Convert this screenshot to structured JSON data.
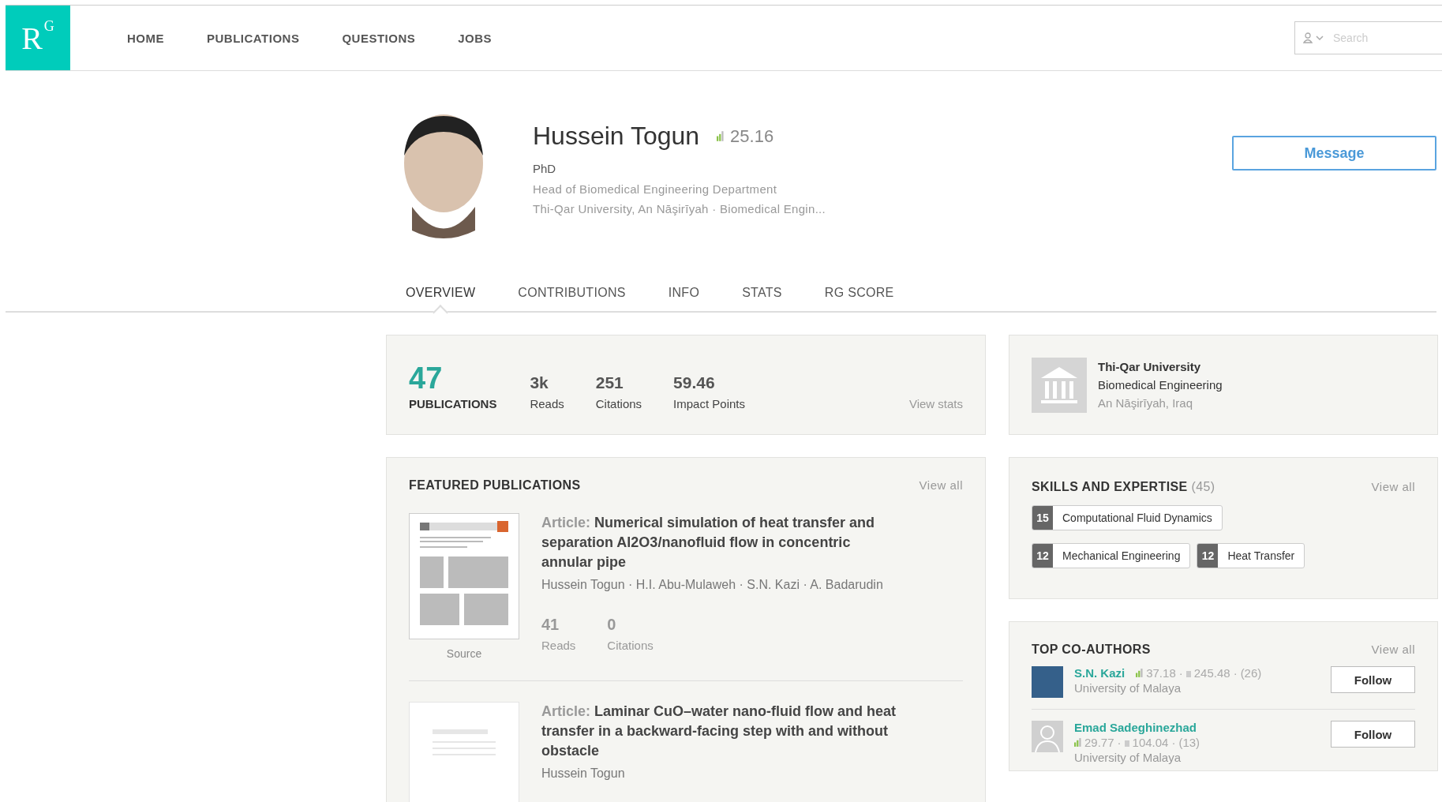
{
  "logo": {
    "letter": "R",
    "superscript": "G"
  },
  "nav": [
    {
      "label": "HOME"
    },
    {
      "label": "PUBLICATIONS"
    },
    {
      "label": "QUESTIONS"
    },
    {
      "label": "JOBS"
    }
  ],
  "search": {
    "placeholder": "Search"
  },
  "profile": {
    "name": "Hussein Togun",
    "score": "25.16",
    "degree": "PhD",
    "position": "Head of Biomedical Engineering Department",
    "affiliation": "Thi-Qar University, An Nāşirīyah · Biomedical Engin..."
  },
  "message_button": "Message",
  "tabs": [
    {
      "label": "OVERVIEW",
      "selected": true
    },
    {
      "label": "CONTRIBUTIONS",
      "selected": false
    },
    {
      "label": "INFO",
      "selected": false
    },
    {
      "label": "STATS",
      "selected": false
    },
    {
      "label": "RG SCORE",
      "selected": false
    }
  ],
  "stats": {
    "publications": {
      "value": "47",
      "label": "PUBLICATIONS"
    },
    "items": [
      {
        "value": "3k",
        "label": "Reads"
      },
      {
        "value": "251",
        "label": "Citations"
      },
      {
        "value": "59.46",
        "label": "Impact Points"
      }
    ],
    "link": "View stats"
  },
  "institution": {
    "name": "Thi-Qar University",
    "department": "Biomedical Engineering",
    "location": "An Nāşirīyah, Iraq"
  },
  "featured": {
    "title": "FEATURED PUBLICATIONS",
    "link": "View all",
    "items": [
      {
        "kind": "document",
        "source": "Source",
        "type": "Article:",
        "title": "Numerical simulation of heat transfer and separation Al2O3/nanofluid flow in concentric annular pipe",
        "authors": "Hussein Togun · H.I. Abu-Mulaweh · S.N. Kazi · A. Badarudin",
        "reads": "41",
        "reads_label": "Reads",
        "citations": "0",
        "citations_label": "Citations"
      },
      {
        "kind": "blank",
        "type": "Article:",
        "title": "Laminar CuO–water nano-fluid flow and heat transfer in a backward-facing step with and without obstacle",
        "authors": "Hussein Togun"
      }
    ]
  },
  "skills": {
    "title": "SKILLS AND EXPERTISE",
    "count": "(45)",
    "link": "View all",
    "items": [
      {
        "count": "15",
        "name": "Computational Fluid Dynamics"
      },
      {
        "count": "12",
        "name": "Mechanical Engineering"
      },
      {
        "count": "12",
        "name": "Heat Transfer"
      }
    ]
  },
  "coauthors": {
    "title": "TOP CO-AUTHORS",
    "link": "View all",
    "items": [
      {
        "kind": "photo",
        "name": "S.N. Kazi",
        "score": "37.18",
        "separators": [
          "·",
          "·"
        ],
        "impact": "245.48",
        "count": "(26)",
        "institution": "University of Malaya",
        "button": "Follow"
      },
      {
        "kind": "silhouette",
        "name": "Emad Sadeghinezhad",
        "score": "29.77",
        "separators": [
          "·",
          "·"
        ],
        "impact": "104.04",
        "count": "(13)",
        "institution": "University of Malaya",
        "button": "Follow"
      }
    ]
  }
}
